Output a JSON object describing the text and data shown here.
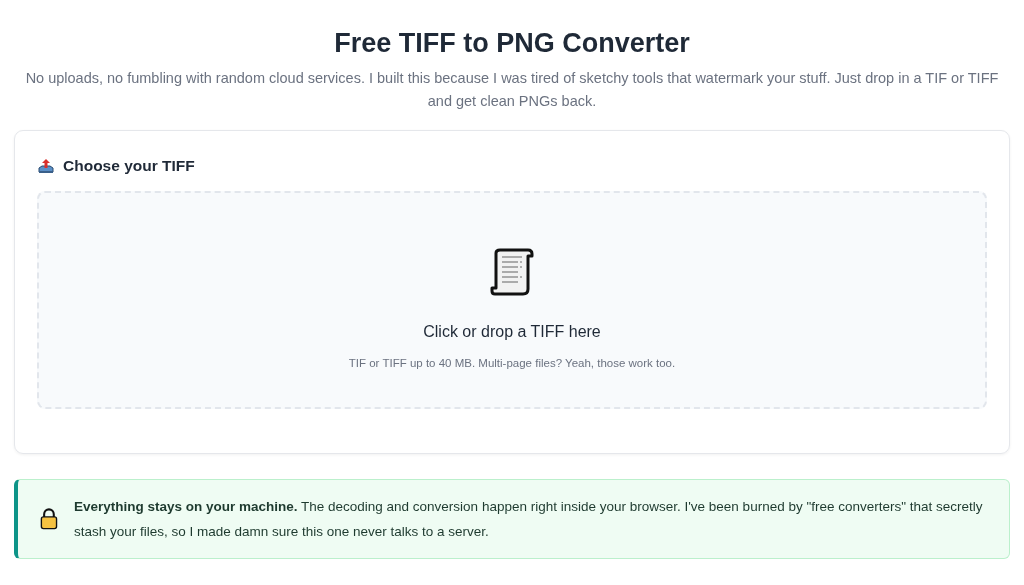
{
  "header": {
    "title": "Free TIFF to PNG Converter",
    "subtitle": "No uploads, no fumbling with random cloud services. I built this because I was tired of sketchy tools that watermark your stuff. Just drop in a TIF or TIFF and get clean PNGs back."
  },
  "upload_card": {
    "heading": "Choose your TIFF",
    "dropzone": {
      "title": "Click or drop a TIFF here",
      "hint": "TIF or TIFF up to 40 MB. Multi-page files? Yeah, those work too."
    }
  },
  "notice": {
    "text": "**Everything stays on your machine.** The decoding and conversion happen right inside your browser. I've been burned by \"free converters\" that secretly stash your files, so I made damn sure this one never talks to a server."
  }
}
